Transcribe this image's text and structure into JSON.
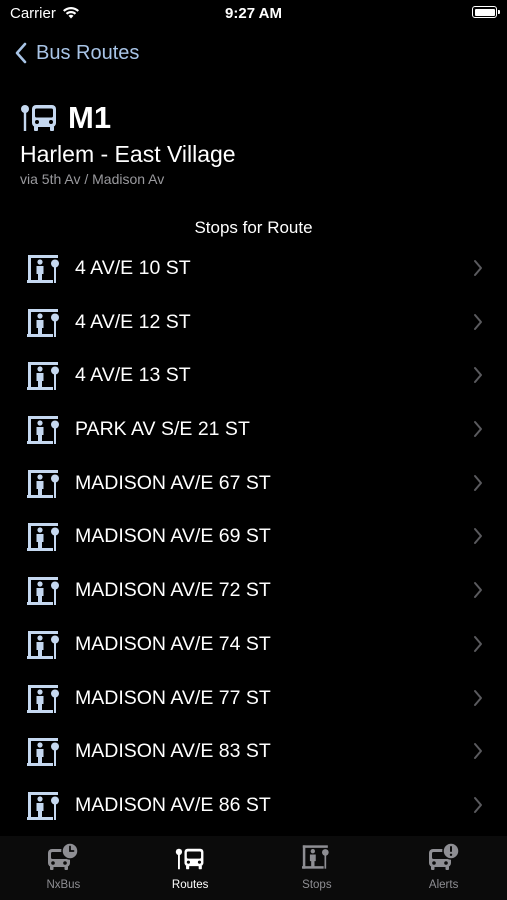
{
  "status_bar": {
    "carrier": "Carrier",
    "time": "9:27 AM"
  },
  "nav": {
    "back_label": "Bus Routes"
  },
  "route": {
    "id": "M1",
    "name": "Harlem - East Village",
    "via": "via 5th Av / Madison Av"
  },
  "section_title": "Stops for Route",
  "stops": [
    {
      "name": "4 AV/E 10 ST"
    },
    {
      "name": "4 AV/E 12 ST"
    },
    {
      "name": "4 AV/E 13 ST"
    },
    {
      "name": "PARK AV S/E 21 ST"
    },
    {
      "name": "MADISON AV/E 67 ST"
    },
    {
      "name": "MADISON AV/E 69 ST"
    },
    {
      "name": "MADISON AV/E 72 ST"
    },
    {
      "name": "MADISON AV/E 74 ST"
    },
    {
      "name": "MADISON AV/E 77 ST"
    },
    {
      "name": "MADISON AV/E 83 ST"
    },
    {
      "name": "MADISON AV/E 86 ST"
    }
  ],
  "tabs": [
    {
      "label": "NxBus",
      "icon": "bus-clock-icon",
      "active": false
    },
    {
      "label": "Routes",
      "icon": "bus-stop-icon",
      "active": true
    },
    {
      "label": "Stops",
      "icon": "bus-shelter-icon",
      "active": false
    },
    {
      "label": "Alerts",
      "icon": "bus-alert-icon",
      "active": false
    }
  ],
  "colors": {
    "background": "#000000",
    "accent": "#a8c4e6",
    "stop_icon": "#c5d8f0",
    "secondary_text": "#9a9a9e",
    "chevron": "#5a5a5e",
    "tab_inactive": "#8e8e93"
  }
}
